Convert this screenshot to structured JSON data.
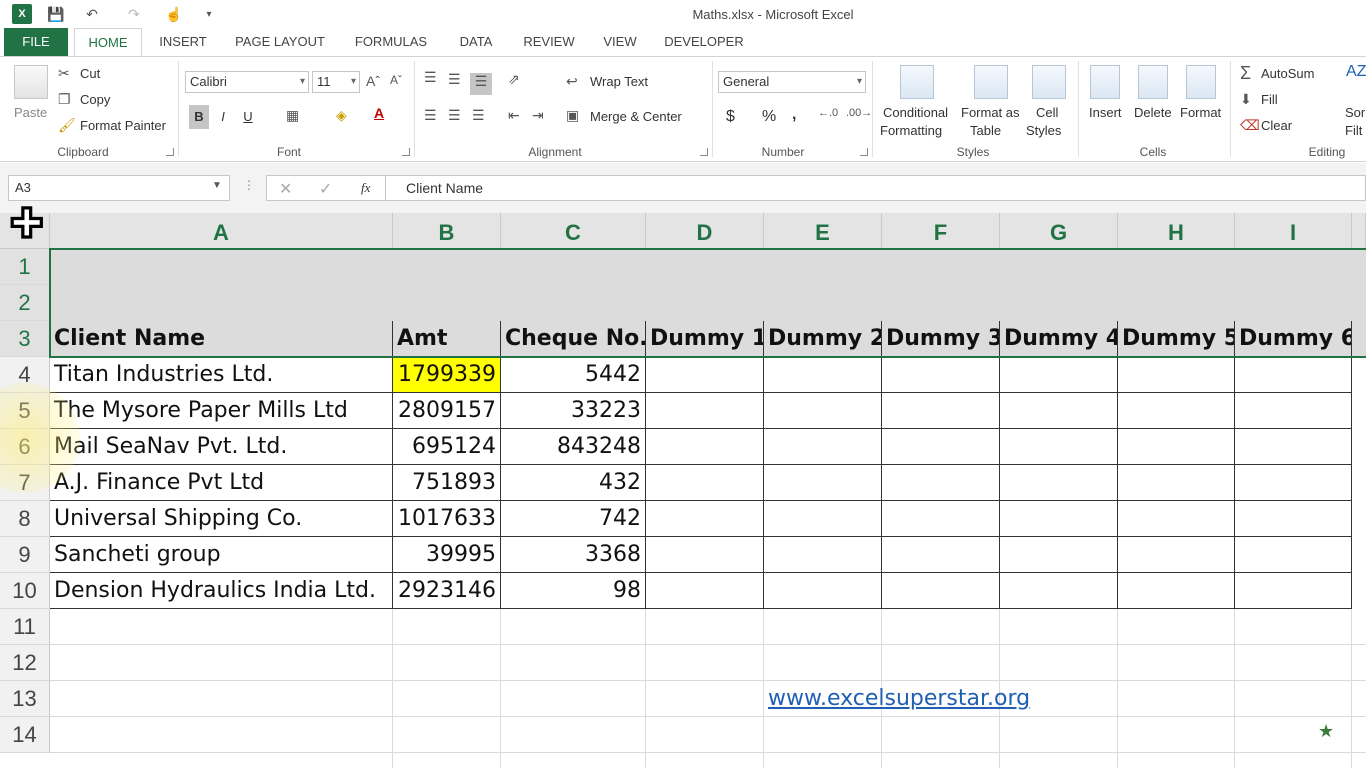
{
  "window": {
    "title": "Maths.xlsx - Microsoft Excel",
    "app_badge": "X"
  },
  "tabs": [
    "FILE",
    "HOME",
    "INSERT",
    "PAGE LAYOUT",
    "FORMULAS",
    "DATA",
    "REVIEW",
    "VIEW",
    "DEVELOPER"
  ],
  "ribbon": {
    "clipboard": {
      "paste": "Paste",
      "cut": "Cut",
      "copy": "Copy",
      "format_painter": "Format Painter",
      "label": "Clipboard"
    },
    "font": {
      "name": "Calibri",
      "size": "11",
      "bold": "B",
      "italic": "I",
      "underline": "U",
      "label": "Font"
    },
    "alignment": {
      "wrap_text": "Wrap Text",
      "merge_center": "Merge & Center",
      "label": "Alignment"
    },
    "number": {
      "format": "General",
      "currency": "$",
      "percent": "%",
      "comma": ",",
      "label": "Number"
    },
    "styles": {
      "conditional_1": "Conditional",
      "conditional_2": "Formatting",
      "format_table_1": "Format as",
      "format_table_2": "Table",
      "cell_styles_1": "Cell",
      "cell_styles_2": "Styles",
      "label": "Styles"
    },
    "cells": {
      "insert": "Insert",
      "delete": "Delete",
      "format": "Format",
      "label": "Cells"
    },
    "editing": {
      "autosum": "AutoSum",
      "fill": "Fill",
      "clear": "Clear",
      "sort_1": "Sor",
      "sort_2": "Filt",
      "label": "Editing"
    }
  },
  "formula_bar": {
    "name_box": "A3",
    "fx": "fx",
    "value": "Client Name"
  },
  "columns": [
    "A",
    "B",
    "C",
    "D",
    "E",
    "F",
    "G",
    "H",
    "I"
  ],
  "rows": [
    "1",
    "2",
    "3",
    "4",
    "5",
    "6",
    "7",
    "8",
    "9",
    "10",
    "11",
    "12",
    "13",
    "14"
  ],
  "headers": [
    "Client Name",
    "Amt",
    "Cheque No.",
    "Dummy 1",
    "Dummy 2",
    "Dummy 3",
    "Dummy 4",
    "Dummy 5",
    "Dummy 6"
  ],
  "data": [
    [
      "Titan Industries Ltd.",
      "1799339",
      "5442"
    ],
    [
      "The Mysore Paper Mills Ltd",
      "2809157",
      "33223"
    ],
    [
      "Mail SeaNav Pvt. Ltd.",
      "695124",
      "843248"
    ],
    [
      "A.J. Finance Pvt Ltd",
      "751893",
      "432"
    ],
    [
      "Universal Shipping Co.",
      "1017633",
      "742"
    ],
    [
      "Sancheti group",
      "39995",
      "3368"
    ],
    [
      "Dension Hydraulics India Ltd.",
      "2923146",
      "98"
    ]
  ],
  "highlight_color": "#ffff00",
  "link": "www.excelsuperstar.org"
}
